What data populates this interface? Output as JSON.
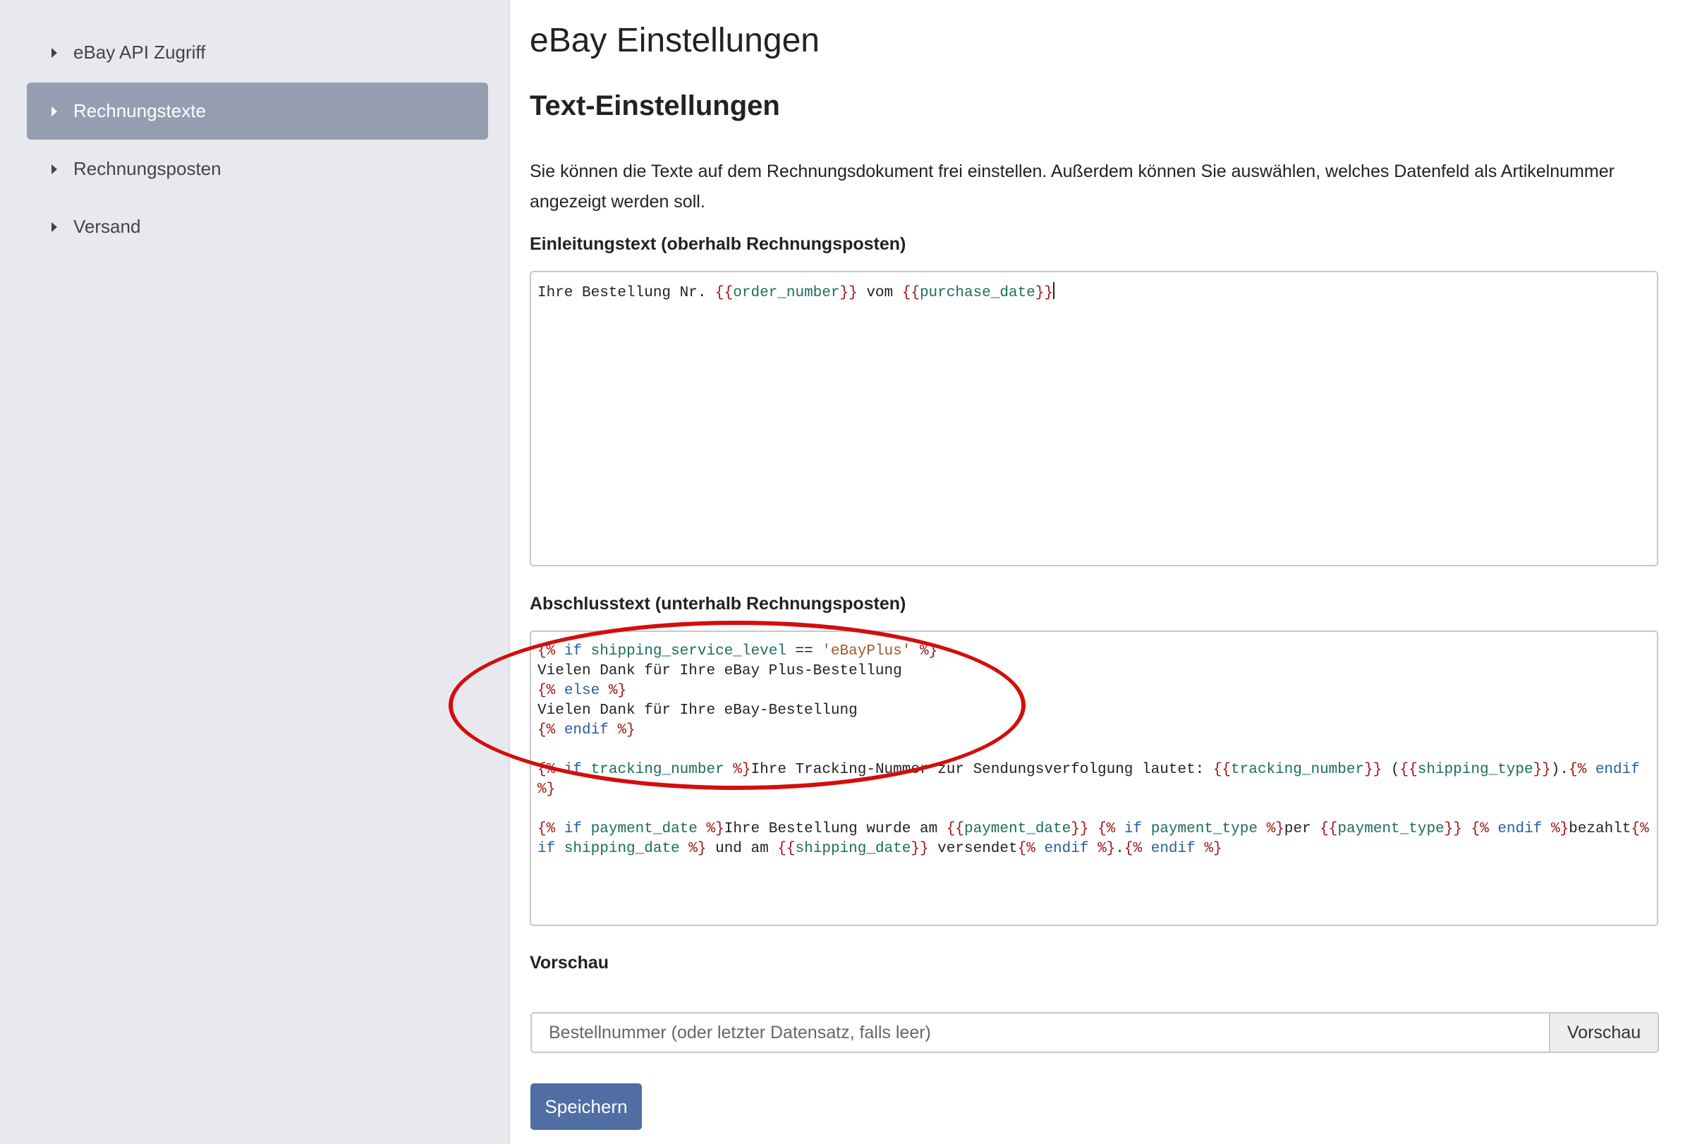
{
  "sidebar": {
    "items": [
      {
        "label": "eBay API Zugriff",
        "active": false
      },
      {
        "label": "Rechnungstexte",
        "active": true
      },
      {
        "label": "Rechnungsposten",
        "active": false
      },
      {
        "label": "Versand",
        "active": false
      }
    ]
  },
  "page": {
    "title": "eBay Einstellungen",
    "section_title": "Text-Einstellungen",
    "intro": "Sie können die Texte auf dem Rechnungsdokument frei einstellen. Außerdem können Sie auswählen, welches Datenfeld als Artikelnummer angezeigt werden soll."
  },
  "intro_field": {
    "label": "Einleitungstext (oberhalb Rechnungsposten)",
    "value": "Ihre Bestellung Nr. {{order_number}} vom {{purchase_date}}"
  },
  "closing_field": {
    "label": "Abschlusstext (unterhalb Rechnungsposten)",
    "lines": [
      "{% if shipping_service_level == 'eBayPlus' %}",
      "Vielen Dank für Ihre eBay Plus-Bestellung",
      "{% else %}",
      "Vielen Dank für Ihre eBay-Bestellung",
      "{% endif %}",
      "",
      "{% if tracking_number %}Ihre Tracking-Nummer zur Sendungsverfolgung lautet: {{tracking_number}} ({{shipping_type}}).{% endif %}",
      "",
      "{% if payment_date %}Ihre Bestellung wurde am {{payment_date}} {% if payment_type %}per {{payment_type}} {% endif %}bezahlt{% if shipping_date %} und am {{shipping_date}} versendet{% endif %}.{% endif %}"
    ]
  },
  "preview": {
    "label": "Vorschau",
    "placeholder": "Bestellnummer (oder letzter Datensatz, falls leer)",
    "button": "Vorschau"
  },
  "save_button": "Speichern",
  "colors": {
    "sidebar_bg": "#e8e9ee",
    "active_item": "#959eb1",
    "primary": "#506da4",
    "annotation": "#d40d0d",
    "template_tag": "#a31515",
    "keyword": "#2a5d9f",
    "variable": "#1c6d5a",
    "string": "#a4572d"
  }
}
